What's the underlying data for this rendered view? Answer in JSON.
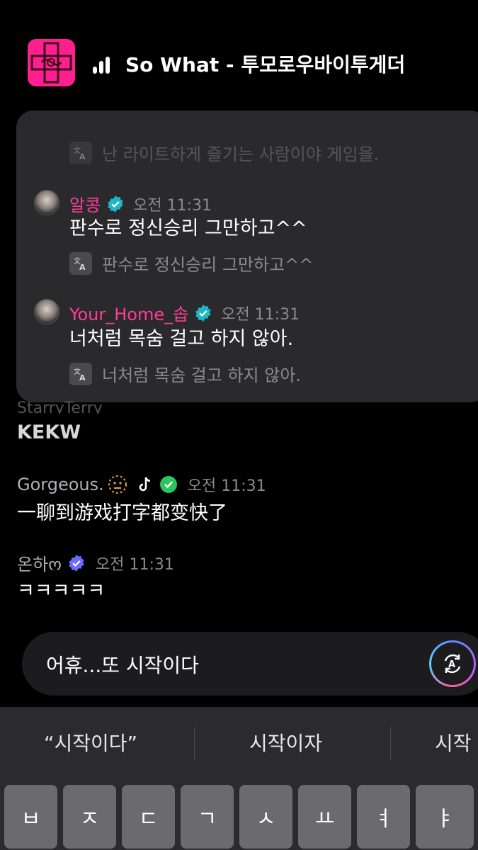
{
  "header": {
    "song_title": "So What - 투모로우바이투게더"
  },
  "overlay": {
    "top_translation": "난 라이트하게 즐기는 사람이야 게임을.",
    "messages": [
      {
        "nickname": "알콩",
        "time": "오전 11:31",
        "text": "판수로 정신승리 그만하고^^",
        "translation": "판수로 정신승리 그만하고^^"
      },
      {
        "nickname": "Your_Home_솝",
        "time": "오전 11:31",
        "text": "너처럼 목숨 걸고 하지 않아.",
        "translation": "너처럼 목숨 걸고 하지 않아."
      }
    ]
  },
  "chat": {
    "partial_user": "StarryTerry",
    "kekw": "KEKW",
    "messages": [
      {
        "username": "Gorgeous.",
        "time": "오전 11:31",
        "text": "一聊到游戏打字都变快了"
      },
      {
        "username": "온하ო",
        "time": "오전 11:31",
        "text": "ㅋㅋㅋㅋㅋ"
      }
    ]
  },
  "input": {
    "value": "어휴...또 시작이다"
  },
  "keyboard": {
    "suggestions": [
      "“시작이다”",
      "시작이자",
      "시작"
    ],
    "keys": [
      "ㅂ",
      "ㅈ",
      "ㄷ",
      "ㄱ",
      "ㅅ",
      "ㅛ",
      "ㅕ",
      "ㅑ"
    ]
  },
  "colors": {
    "nickname": "#ff3d98",
    "verified": "#1fb6c9",
    "card_bg": "#2a2a2c"
  }
}
